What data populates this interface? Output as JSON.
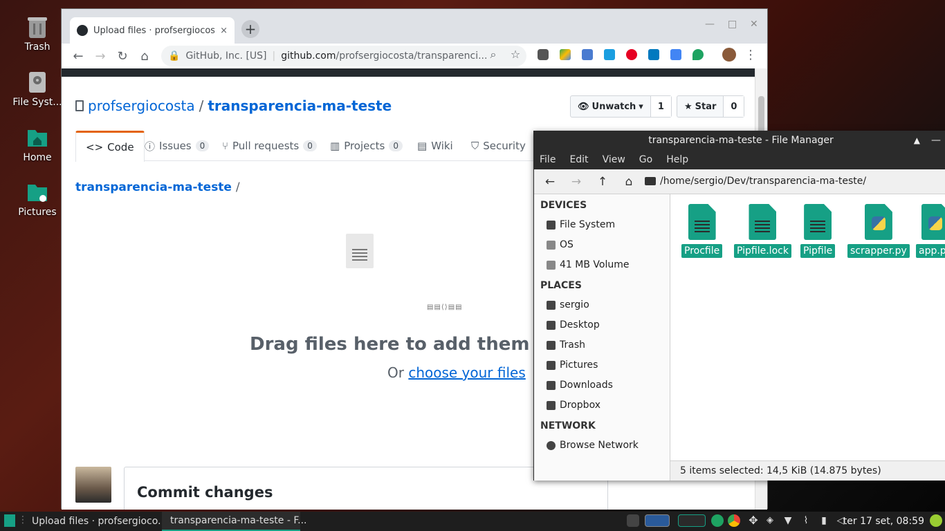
{
  "desktop": {
    "icons": [
      {
        "label": "Trash"
      },
      {
        "label": "File Syst..."
      },
      {
        "label": "Home"
      },
      {
        "label": "Pictures"
      }
    ]
  },
  "browser": {
    "tab_title": "Upload files · profsergiocosta",
    "tab_close": "×",
    "new_tab": "+",
    "win_min": "—",
    "win_max": "□",
    "win_close": "✕",
    "back": "←",
    "forward": "→",
    "reload": "↻",
    "home": "⌂",
    "site_identity": "GitHub, Inc. [US]",
    "url_host": "github.com",
    "url_path": "/profsergiocosta/transparenci...",
    "menu": "⋮"
  },
  "github": {
    "owner": "profsergiocosta",
    "slash": "/",
    "repo": "transparencia-ma-teste",
    "watch_label": "Unwatch",
    "watch_count": "1",
    "star_label": "Star",
    "star_count": "0",
    "tabs": [
      {
        "label": "Code",
        "icon": "<>",
        "count": ""
      },
      {
        "label": "Issues",
        "icon": "ⓘ",
        "count": "0"
      },
      {
        "label": "Pull requests",
        "icon": "⑂",
        "count": "0"
      },
      {
        "label": "Projects",
        "icon": "▥",
        "count": "0"
      },
      {
        "label": "Wiki",
        "icon": "▤",
        "count": ""
      },
      {
        "label": "Security",
        "icon": "⛉",
        "count": ""
      }
    ],
    "breadcrumb_repo": "transparencia-ma-teste",
    "breadcrumb_sep": "/",
    "drag_text": "Drag files here to add them to yo",
    "or_text": "Or",
    "choose_link": "choose your files",
    "commit_heading": "Commit changes"
  },
  "file_manager": {
    "title": "transparencia-ma-teste - File Manager",
    "menu": [
      "File",
      "Edit",
      "View",
      "Go",
      "Help"
    ],
    "path": "/home/sergio/Dev/transparencia-ma-teste/",
    "sections": {
      "devices": "DEVICES",
      "places": "PLACES",
      "network": "NETWORK"
    },
    "devices": [
      "File System",
      "OS",
      "41 MB Volume"
    ],
    "places": [
      "sergio",
      "Desktop",
      "Trash",
      "Pictures",
      "Downloads",
      "Dropbox"
    ],
    "network": [
      "Browse Network"
    ],
    "files": [
      {
        "name": "Procfile",
        "icon": "text-file-icon"
      },
      {
        "name": "Pipfile.lock",
        "icon": "text-file-icon"
      },
      {
        "name": "Pipfile",
        "icon": "text-file-icon"
      },
      {
        "name": "scrapper.py",
        "icon": "python-file-icon"
      },
      {
        "name": "app.py",
        "icon": "python-file-icon"
      }
    ],
    "status": "5 items selected: 14,5 KiB (14.875 bytes)"
  },
  "taskbar": {
    "tasks": [
      "Upload files · profsergioco...",
      "transparencia-ma-teste - F..."
    ],
    "clock": "ter 17 set, 08:59"
  },
  "colors": {
    "accent": "#16a085",
    "link": "#0366d6",
    "tab_underline": "#e36209"
  }
}
